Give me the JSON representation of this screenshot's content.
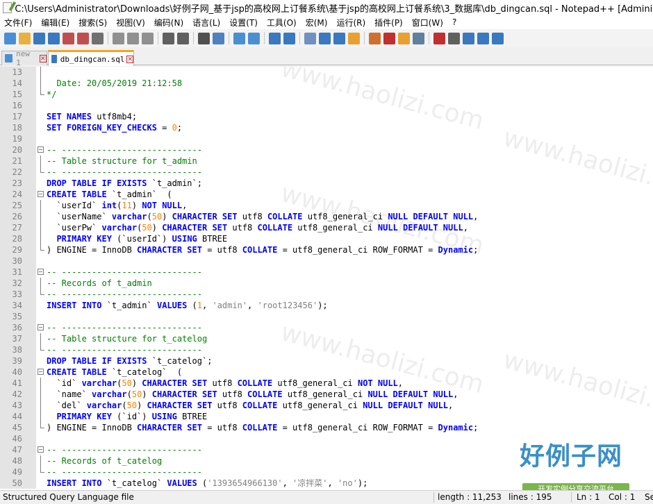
{
  "window": {
    "title": "C:\\Users\\Administrator\\Downloads\\好例子网_基于jsp的高校网上订餐系统\\基于jsp的高校网上订餐系统\\3_数据库\\db_dingcan.sql - Notepad++ [Administrator]"
  },
  "menu": [
    "文件(F)",
    "编辑(E)",
    "搜索(S)",
    "视图(V)",
    "编码(N)",
    "语言(L)",
    "设置(T)",
    "工具(O)",
    "宏(M)",
    "运行(R)",
    "插件(P)",
    "窗口(W)",
    "?"
  ],
  "toolbar": [
    "new-file",
    "open-file",
    "save",
    "save-all",
    "close",
    "close-all",
    "print",
    "cut",
    "copy",
    "paste",
    "undo",
    "redo",
    "find",
    "replace",
    "zoom-in",
    "zoom-out",
    "sync-v",
    "sync-h",
    "wrap",
    "all-chars",
    "indent-guide",
    "udl",
    "doc-map",
    "function-list",
    "folder-workspace",
    "monitor",
    "record",
    "stop",
    "play",
    "play-multi",
    "save-macro"
  ],
  "tabs": [
    {
      "label": "new 1",
      "active": false
    },
    {
      "label": "db_dingcan.sql",
      "active": true
    }
  ],
  "colors": {
    "keyword": "#0000ff",
    "keyword_alt": "#8000ff",
    "comment": "#008000",
    "string": "#808080",
    "number": "#ff8000",
    "text": "#000000",
    "tab_accent": "#f4a623"
  },
  "lines": [
    {
      "n": "13",
      "fold": "line",
      "tokens": []
    },
    {
      "n": "14",
      "fold": "line",
      "tokens": [
        {
          "t": "  Date: 20/05/2019 21:12:58",
          "c": "comment"
        }
      ]
    },
    {
      "n": "15",
      "fold": "end",
      "tokens": [
        {
          "t": "*/",
          "c": "comment"
        }
      ]
    },
    {
      "n": "16",
      "fold": "",
      "tokens": []
    },
    {
      "n": "17",
      "fold": "",
      "tokens": [
        {
          "t": "SET NAMES",
          "c": "keyword"
        },
        {
          "t": " utf8mb4;",
          "c": "text"
        }
      ]
    },
    {
      "n": "18",
      "fold": "",
      "tokens": [
        {
          "t": "SET FOREIGN_KEY_CHECKS",
          "c": "keyword"
        },
        {
          "t": " = ",
          "c": "text"
        },
        {
          "t": "0",
          "c": "number"
        },
        {
          "t": ";",
          "c": "text"
        }
      ]
    },
    {
      "n": "19",
      "fold": "",
      "tokens": []
    },
    {
      "n": "20",
      "fold": "box",
      "tokens": [
        {
          "t": "-- ----------------------------",
          "c": "comment"
        }
      ]
    },
    {
      "n": "21",
      "fold": "line",
      "tokens": [
        {
          "t": "-- Table structure for t_admin",
          "c": "comment"
        }
      ]
    },
    {
      "n": "22",
      "fold": "end",
      "tokens": [
        {
          "t": "-- ----------------------------",
          "c": "comment"
        }
      ]
    },
    {
      "n": "23",
      "fold": "",
      "tokens": [
        {
          "t": "DROP TABLE IF EXISTS",
          "c": "keyword"
        },
        {
          "t": " `t_admin`;",
          "c": "text"
        }
      ]
    },
    {
      "n": "24",
      "fold": "box",
      "tokens": [
        {
          "t": "CREATE TABLE",
          "c": "keyword"
        },
        {
          "t": " `t_admin`  (",
          "c": "text"
        }
      ]
    },
    {
      "n": "25",
      "fold": "line",
      "tokens": [
        {
          "t": "  `userId` ",
          "c": "text"
        },
        {
          "t": "int",
          "c": "keyword"
        },
        {
          "t": "(",
          "c": "text"
        },
        {
          "t": "11",
          "c": "number"
        },
        {
          "t": ") ",
          "c": "text"
        },
        {
          "t": "NOT NULL",
          "c": "keyword"
        },
        {
          "t": ",",
          "c": "text"
        }
      ]
    },
    {
      "n": "26",
      "fold": "line",
      "tokens": [
        {
          "t": "  `userName` ",
          "c": "text"
        },
        {
          "t": "varchar",
          "c": "keyword"
        },
        {
          "t": "(",
          "c": "text"
        },
        {
          "t": "50",
          "c": "number"
        },
        {
          "t": ") ",
          "c": "text"
        },
        {
          "t": "CHARACTER SET",
          "c": "keyword"
        },
        {
          "t": " utf8 ",
          "c": "text"
        },
        {
          "t": "COLLATE",
          "c": "keyword"
        },
        {
          "t": " utf8_general_ci ",
          "c": "text"
        },
        {
          "t": "NULL DEFAULT NULL",
          "c": "keyword"
        },
        {
          "t": ",",
          "c": "text"
        }
      ]
    },
    {
      "n": "27",
      "fold": "line",
      "tokens": [
        {
          "t": "  `userPw` ",
          "c": "text"
        },
        {
          "t": "varchar",
          "c": "keyword"
        },
        {
          "t": "(",
          "c": "text"
        },
        {
          "t": "50",
          "c": "number"
        },
        {
          "t": ") ",
          "c": "text"
        },
        {
          "t": "CHARACTER SET",
          "c": "keyword"
        },
        {
          "t": " utf8 ",
          "c": "text"
        },
        {
          "t": "COLLATE",
          "c": "keyword"
        },
        {
          "t": " utf8_general_ci ",
          "c": "text"
        },
        {
          "t": "NULL DEFAULT NULL",
          "c": "keyword"
        },
        {
          "t": ",",
          "c": "text"
        }
      ]
    },
    {
      "n": "28",
      "fold": "line",
      "tokens": [
        {
          "t": "  ",
          "c": "text"
        },
        {
          "t": "PRIMARY KEY",
          "c": "keyword"
        },
        {
          "t": " (`userId`) ",
          "c": "text"
        },
        {
          "t": "USING",
          "c": "keyword"
        },
        {
          "t": " BTREE",
          "c": "text"
        }
      ]
    },
    {
      "n": "29",
      "fold": "end",
      "tokens": [
        {
          "t": ") ENGINE = InnoDB ",
          "c": "text"
        },
        {
          "t": "CHARACTER SET",
          "c": "keyword"
        },
        {
          "t": " = utf8 ",
          "c": "text"
        },
        {
          "t": "COLLATE",
          "c": "keyword"
        },
        {
          "t": " = utf8_general_ci ROW_FORMAT = ",
          "c": "text"
        },
        {
          "t": "Dynamic",
          "c": "keyword"
        },
        {
          "t": ";",
          "c": "text"
        }
      ]
    },
    {
      "n": "30",
      "fold": "",
      "tokens": []
    },
    {
      "n": "31",
      "fold": "box",
      "tokens": [
        {
          "t": "-- ----------------------------",
          "c": "comment"
        }
      ]
    },
    {
      "n": "32",
      "fold": "line",
      "tokens": [
        {
          "t": "-- Records of t_admin",
          "c": "comment"
        }
      ]
    },
    {
      "n": "33",
      "fold": "end",
      "tokens": [
        {
          "t": "-- ----------------------------",
          "c": "comment"
        }
      ]
    },
    {
      "n": "34",
      "fold": "",
      "tokens": [
        {
          "t": "INSERT INTO",
          "c": "keyword"
        },
        {
          "t": " `t_admin` ",
          "c": "text"
        },
        {
          "t": "VALUES",
          "c": "keyword"
        },
        {
          "t": " (",
          "c": "text"
        },
        {
          "t": "1",
          "c": "number"
        },
        {
          "t": ", ",
          "c": "text"
        },
        {
          "t": "'admin'",
          "c": "string"
        },
        {
          "t": ", ",
          "c": "text"
        },
        {
          "t": "'root123456'",
          "c": "string"
        },
        {
          "t": ");",
          "c": "text"
        }
      ]
    },
    {
      "n": "35",
      "fold": "",
      "tokens": []
    },
    {
      "n": "36",
      "fold": "box",
      "tokens": [
        {
          "t": "-- ----------------------------",
          "c": "comment"
        }
      ]
    },
    {
      "n": "37",
      "fold": "line",
      "tokens": [
        {
          "t": "-- Table structure for t_catelog",
          "c": "comment"
        }
      ]
    },
    {
      "n": "38",
      "fold": "end",
      "tokens": [
        {
          "t": "-- ----------------------------",
          "c": "comment"
        }
      ]
    },
    {
      "n": "39",
      "fold": "",
      "tokens": [
        {
          "t": "DROP TABLE IF EXISTS",
          "c": "keyword"
        },
        {
          "t": " `t_catelog`;",
          "c": "text"
        }
      ]
    },
    {
      "n": "40",
      "fold": "box",
      "tokens": [
        {
          "t": "CREATE TABLE",
          "c": "keyword"
        },
        {
          "t": " `t_catelog`  (",
          "c": "text"
        }
      ]
    },
    {
      "n": "41",
      "fold": "line",
      "tokens": [
        {
          "t": "  `id` ",
          "c": "text"
        },
        {
          "t": "varchar",
          "c": "keyword"
        },
        {
          "t": "(",
          "c": "text"
        },
        {
          "t": "50",
          "c": "number"
        },
        {
          "t": ") ",
          "c": "text"
        },
        {
          "t": "CHARACTER SET",
          "c": "keyword"
        },
        {
          "t": " utf8 ",
          "c": "text"
        },
        {
          "t": "COLLATE",
          "c": "keyword"
        },
        {
          "t": " utf8_general_ci ",
          "c": "text"
        },
        {
          "t": "NOT NULL",
          "c": "keyword"
        },
        {
          "t": ",",
          "c": "text"
        }
      ]
    },
    {
      "n": "42",
      "fold": "line",
      "tokens": [
        {
          "t": "  `name` ",
          "c": "text"
        },
        {
          "t": "varchar",
          "c": "keyword"
        },
        {
          "t": "(",
          "c": "text"
        },
        {
          "t": "50",
          "c": "number"
        },
        {
          "t": ") ",
          "c": "text"
        },
        {
          "t": "CHARACTER SET",
          "c": "keyword"
        },
        {
          "t": " utf8 ",
          "c": "text"
        },
        {
          "t": "COLLATE",
          "c": "keyword"
        },
        {
          "t": " utf8_general_ci ",
          "c": "text"
        },
        {
          "t": "NULL DEFAULT NULL",
          "c": "keyword"
        },
        {
          "t": ",",
          "c": "text"
        }
      ]
    },
    {
      "n": "43",
      "fold": "line",
      "tokens": [
        {
          "t": "  `del` ",
          "c": "text"
        },
        {
          "t": "varchar",
          "c": "keyword"
        },
        {
          "t": "(",
          "c": "text"
        },
        {
          "t": "50",
          "c": "number"
        },
        {
          "t": ") ",
          "c": "text"
        },
        {
          "t": "CHARACTER SET",
          "c": "keyword"
        },
        {
          "t": " utf8 ",
          "c": "text"
        },
        {
          "t": "COLLATE",
          "c": "keyword"
        },
        {
          "t": " utf8_general_ci ",
          "c": "text"
        },
        {
          "t": "NULL DEFAULT NULL",
          "c": "keyword"
        },
        {
          "t": ",",
          "c": "text"
        }
      ]
    },
    {
      "n": "44",
      "fold": "line",
      "tokens": [
        {
          "t": "  ",
          "c": "text"
        },
        {
          "t": "PRIMARY KEY",
          "c": "keyword"
        },
        {
          "t": " (`id`) ",
          "c": "text"
        },
        {
          "t": "USING",
          "c": "keyword"
        },
        {
          "t": " BTREE",
          "c": "text"
        }
      ]
    },
    {
      "n": "45",
      "fold": "end",
      "tokens": [
        {
          "t": ") ENGINE = InnoDB ",
          "c": "text"
        },
        {
          "t": "CHARACTER SET",
          "c": "keyword"
        },
        {
          "t": " = utf8 ",
          "c": "text"
        },
        {
          "t": "COLLATE",
          "c": "keyword"
        },
        {
          "t": " = utf8_general_ci ROW_FORMAT = ",
          "c": "text"
        },
        {
          "t": "Dynamic",
          "c": "keyword"
        },
        {
          "t": ";",
          "c": "text"
        }
      ]
    },
    {
      "n": "46",
      "fold": "",
      "tokens": []
    },
    {
      "n": "47",
      "fold": "box",
      "tokens": [
        {
          "t": "-- ----------------------------",
          "c": "comment"
        }
      ]
    },
    {
      "n": "48",
      "fold": "line",
      "tokens": [
        {
          "t": "-- Records of t_catelog",
          "c": "comment"
        }
      ]
    },
    {
      "n": "49",
      "fold": "end",
      "tokens": [
        {
          "t": "-- ----------------------------",
          "c": "comment"
        }
      ]
    },
    {
      "n": "50",
      "fold": "",
      "tokens": [
        {
          "t": "INSERT INTO",
          "c": "keyword"
        },
        {
          "t": " `t_catelog` ",
          "c": "text"
        },
        {
          "t": "VALUES",
          "c": "keyword"
        },
        {
          "t": " (",
          "c": "text"
        },
        {
          "t": "'1393654966130'",
          "c": "string"
        },
        {
          "t": ", ",
          "c": "text"
        },
        {
          "t": "'凉拌菜'",
          "c": "string"
        },
        {
          "t": ", ",
          "c": "text"
        },
        {
          "t": "'no'",
          "c": "string"
        },
        {
          "t": ");",
          "c": "text"
        }
      ]
    }
  ],
  "watermark": {
    "text": "www.haolizi.com",
    "logo": "好例子网",
    "slogan": "开发实例分享交流平台"
  },
  "status": {
    "language": "Structured Query Language file",
    "length": "length : 11,253",
    "lines": "lines : 195",
    "ln": "Ln : 1",
    "col": "Col : 1",
    "sel": "Se"
  }
}
